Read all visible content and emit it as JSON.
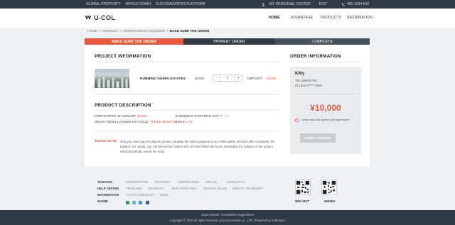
{
  "topbar": {
    "links": [
      "GLOBAL PROPERTY",
      "WHOLE CHAIN",
      "CUSTOMIZATION PLATFORM"
    ],
    "personal_center": "MY PERSONAL CENTER",
    "exit": "EXIT",
    "phone": "400-1234-666"
  },
  "header": {
    "logo": "U-COL",
    "nav": [
      "HOME",
      "ADVANTAGE",
      "PRODUCTS",
      "INFORMATION"
    ]
  },
  "breadcrumb": [
    "HOME",
    "PRODUCT",
    "INTERNATIONAL MANSION",
    "MAKE SURE THE ORDER"
  ],
  "steps": [
    "MAKE SURE THE ORDER",
    "PAYMENT ORDER",
    "COMPLETE"
  ],
  "project": {
    "section_title": "PROJECT INFORMATION",
    "name": "KUNMING GUIHAI ESTATES",
    "price": "$1000",
    "quantity": "1",
    "minus": "−",
    "plus": "+",
    "deposit_label": "DEPOSIT",
    "deposit_value": "$1000"
  },
  "description": {
    "section_title": "PRODUCT DESCRIPTION",
    "amount_label": "PARTICIPATE IN AMOUNT:",
    "amount_value": "$1000",
    "earnings_label": "EARNINGS STARTING DAY:",
    "earnings_value": "T + 1",
    "cycle_label": "SELECTIONS LOCKED-IN CYCLE:",
    "cycle_value": "THREE MONTHS",
    "fees_label": "FEES:",
    "fees_value": "3 ‰"
  },
  "tips": {
    "label": "TRADE SHOW",
    "text": "Now you order pay the deposit, please complete the online payment to our offline within 48 hours after completion the balance, if in doubt, can call free service hotline 400-123-456 Within 48 hours not swallow the balance of the system will automatically cancel the order."
  },
  "order": {
    "section_title": "ORDER INFORMATION",
    "name": "Kitty",
    "tel": "TEL:158092736",
    "id": "ID:130125*****4568",
    "amount": "¥10,000",
    "agree_text": "I have read and agree to the agreement",
    "submit_label": "SUBMIT ORDERS"
  },
  "footer": {
    "tuocool": "TUOCOOL",
    "help_center": "HELP CENTER",
    "information": "INFORMATION",
    "share": "SHARE",
    "row1_links": [
      "INTRODUCTION",
      "PARTNERS",
      "COOPERATION",
      "JOIN US",
      "CONTACT US"
    ],
    "row2_links": [
      "PROBLEMS",
      "FEEDBACK",
      "NEW GUIDELINES",
      "TRADING RULES",
      "PRIVACY STATEMENT"
    ],
    "row3_links": [
      "ACTIVITY/INDUSTRY",
      "NEWS"
    ],
    "wechat": "WECHAT",
    "weibo": "WEIBO",
    "legal": "Legal notices  |  Complaints Suggestions",
    "copyright": "Copyright © 2015  All rights reserved. youcool network co., LTD  |  Powered by Xinhongru"
  },
  "colors": {
    "accent": "#e9583a",
    "dark": "#2f3a45"
  }
}
